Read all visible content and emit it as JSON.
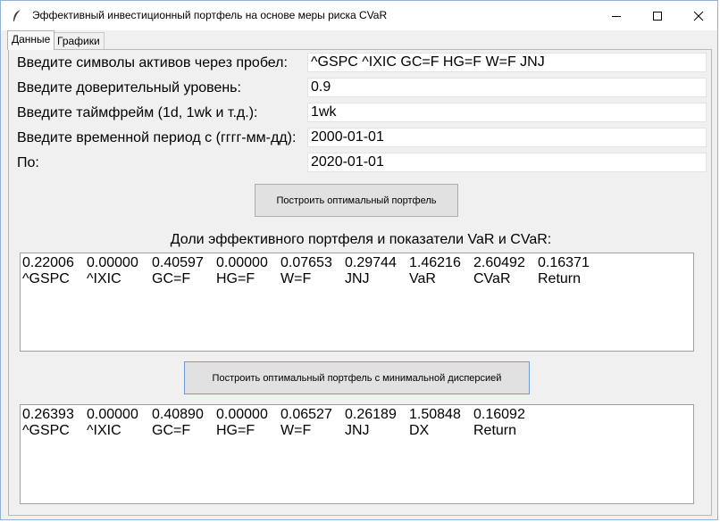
{
  "window": {
    "title": "Эффективный инвестиционный портфель на основе меры риска CVaR"
  },
  "tabs": [
    {
      "label": "Данные"
    },
    {
      "label": "Графики"
    }
  ],
  "form": {
    "assets_label": "Введите символы активов через пробел:",
    "assets_value": "^GSPC ^IXIC GC=F HG=F W=F JNJ",
    "confidence_label": "Введите доверительный уровень:",
    "confidence_value": "0.9",
    "timeframe_label": "Введите таймфрейм (1d, 1wk и т.д.):",
    "timeframe_value": "1wk",
    "start_label": "Введите временной период с (гггг-мм-дд):",
    "start_value": "2000-01-01",
    "end_label": "По:",
    "end_value": "2020-01-01"
  },
  "buttons": {
    "optimal": "Построить оптимальный портфель",
    "min_variance": "Построить оптимальный портфель с минимальной дисперсией"
  },
  "results_label": "Доли эффективного портфеля и показатели VaR и CVaR:",
  "cvar_result": {
    "values": [
      "0.22006",
      "0.00000",
      "0.40597",
      "0.00000",
      "0.07653",
      "0.29744",
      "1.46216",
      "2.60492",
      "0.16371"
    ],
    "names": [
      "^GSPC",
      "^IXIC",
      "GC=F",
      "HG=F",
      "W=F",
      "JNJ",
      "VaR",
      "CVaR",
      "Return"
    ]
  },
  "minvar_result": {
    "values": [
      "0.26393",
      "0.00000",
      "0.40890",
      "0.00000",
      "0.06527",
      "0.26189",
      "1.50848",
      "0.16092"
    ],
    "names": [
      "^GSPC",
      "^IXIC",
      "GC=F",
      "HG=F",
      "W=F",
      "JNJ",
      "DX",
      "Return"
    ]
  }
}
